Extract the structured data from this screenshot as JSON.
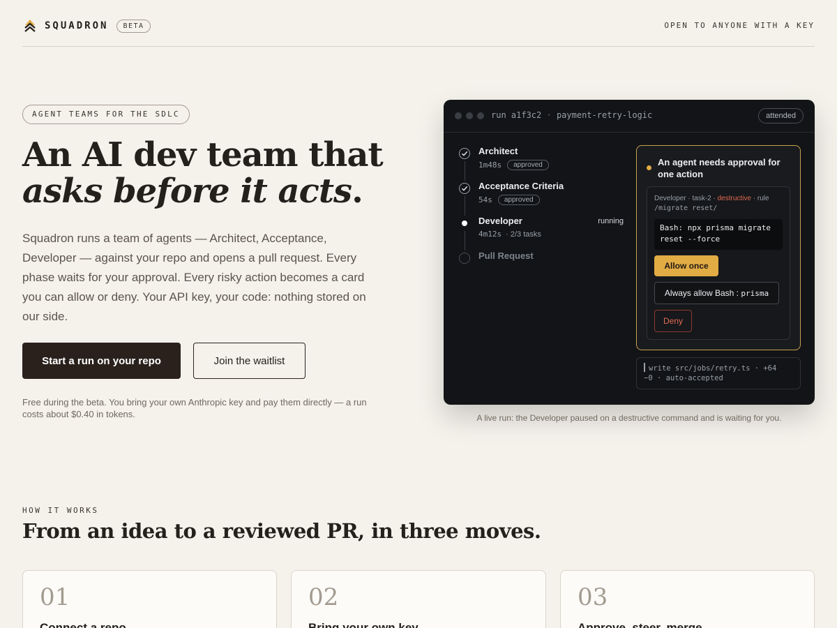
{
  "header": {
    "brand": "SQUADRON",
    "badge": "BETA",
    "tagline": "OPEN TO ANYONE WITH A KEY"
  },
  "hero": {
    "eyebrow": "AGENT TEAMS FOR THE SDLC",
    "title_line1": "An AI dev team that",
    "title_line2": "asks before it acts",
    "title_period": ".",
    "lead": "Squadron runs a team of agents — Architect, Acceptance, Developer — against your repo and opens a pull request. Every phase waits for your approval. Every risky action becomes a card you can allow or deny. Your API key, your code: nothing stored on our side.",
    "primary_cta": "Start a run on your repo",
    "secondary_cta": "Join the waitlist",
    "fineprint": "Free during the beta. You bring your own Anthropic key and pay them directly — a run costs about $0.40 in tokens."
  },
  "terminal": {
    "run_id": "run a1f3c2",
    "separator": "·",
    "run_name": "payment-retry-logic",
    "mode_badge": "attended",
    "phases": [
      {
        "name": "Architect",
        "duration": "1m48s",
        "status": "approved"
      },
      {
        "name": "Acceptance Criteria",
        "duration": "54s",
        "status": "approved"
      },
      {
        "name": "Developer",
        "duration": "4m12s",
        "tasks": "· 2/3 tasks",
        "status": "running"
      },
      {
        "name": "Pull Request"
      }
    ],
    "approval": {
      "title": "An agent needs approval for one action",
      "agent": "Developer",
      "task": "task-2",
      "risk": "destructive",
      "rule_label": "rule",
      "rule": "/migrate reset/",
      "command_line1": "Bash: npx prisma migrate",
      "command_line2": "reset --force",
      "allow_once": "Allow once",
      "always_allow": "Always allow Bash",
      "always_allow_sep": ":",
      "always_allow_code": "prisma",
      "deny": "Deny"
    },
    "log_line1": "write src/jobs/retry.ts · +64",
    "log_line2": "−0 · auto-accepted"
  },
  "caption": "A live run: the Developer paused on a destructive command and is waiting for you.",
  "how": {
    "eyebrow": "HOW IT WORKS",
    "title": "From an idea to a reviewed PR, in three moves.",
    "steps": [
      {
        "num": "01",
        "title": "Connect a repo"
      },
      {
        "num": "02",
        "title": "Bring your own key"
      },
      {
        "num": "03",
        "title": "Approve, steer, merge"
      }
    ]
  },
  "colors": {
    "background": "#f5f2ec",
    "ink": "#24201c",
    "accent": "#e2ac45",
    "danger": "#e26a52",
    "terminal_bg": "#121417"
  }
}
